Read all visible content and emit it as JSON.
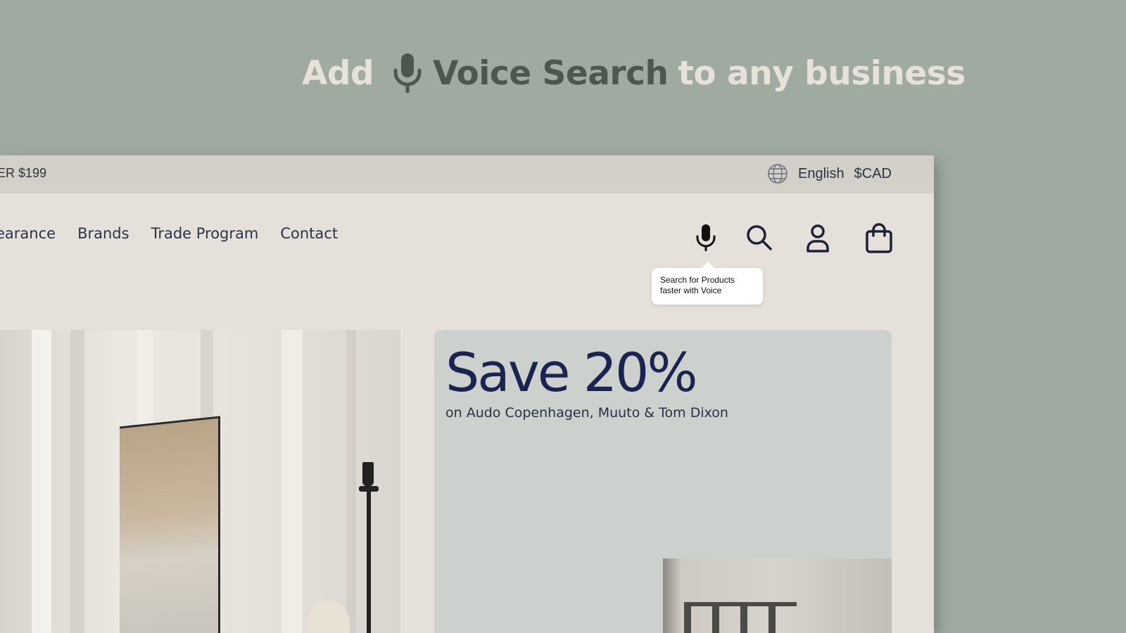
{
  "headline": {
    "add": "Add",
    "strong": "Voice Search",
    "rest": "to any business"
  },
  "topbar": {
    "promo": "ER $199",
    "language": "English",
    "currency": "$CAD"
  },
  "nav": {
    "items": [
      "earance",
      "Brands",
      "Trade Program",
      "Contact"
    ]
  },
  "tooltip": {
    "line1": "Search for Products",
    "line2": "faster with Voice"
  },
  "promo_card": {
    "title": "Save 20%",
    "subtitle": "on Audo Copenhagen, Muuto & Tom Dixon"
  },
  "icons": [
    "microphone-icon",
    "search-icon",
    "account-icon",
    "shopping-bag-icon",
    "globe-icon"
  ],
  "colors": {
    "background": "#9faaa1",
    "headline_light": "#e7e2d9",
    "headline_dark": "#4d574f",
    "store_bg": "#e5e1da",
    "topbar_bg": "#d3cfc9",
    "navy": "#1b2350",
    "card_bg": "#ccd1cd"
  }
}
